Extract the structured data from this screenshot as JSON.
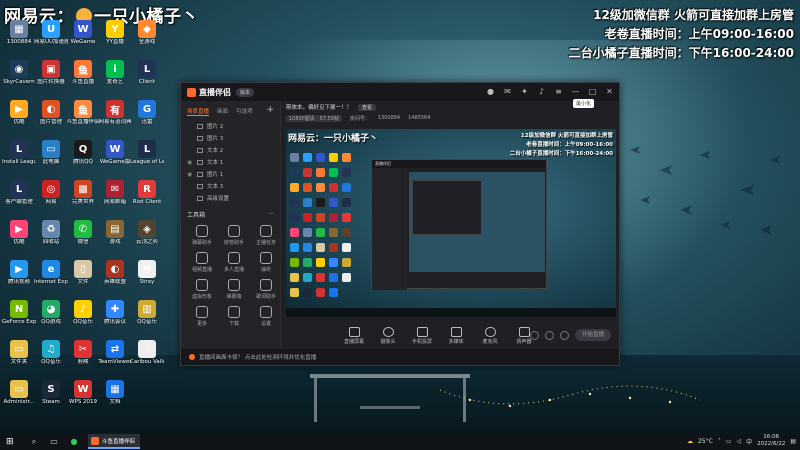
{
  "overlay": {
    "title_left": "网易云：",
    "title_right": "一只小橘子丶",
    "info_lines": [
      "12级加微信群 火箭可直接加群上房管",
      "老卷直播时间：上午09:00-16:00",
      "二台小橘子直播时间：下午16:00-24:00"
    ]
  },
  "desktop_icons": [
    {
      "label": "1300884",
      "color": "#6b7fa0",
      "glyph": "▦"
    },
    {
      "label": "网易UU加速器",
      "color": "#2aa0ff",
      "glyph": "U"
    },
    {
      "label": "WeGame",
      "color": "#3355cc",
      "glyph": "W"
    },
    {
      "label": "YY直播",
      "color": "#ffcc00",
      "glyph": "Y"
    },
    {
      "label": "全游戏",
      "color": "#ff8833",
      "glyph": "◆"
    },
    {
      "label": "SkyrCavern",
      "color": "#1d3b58",
      "glyph": "◉"
    },
    {
      "label": "图片转换器",
      "color": "#cc3333",
      "glyph": "▣"
    },
    {
      "label": "斗鱼直播",
      "color": "#ff7733",
      "glyph": "鱼"
    },
    {
      "label": "爱奇艺",
      "color": "#00c050",
      "glyph": "i"
    },
    {
      "label": "Client",
      "color": "#223355",
      "glyph": "L"
    },
    {
      "label": "优酷",
      "color": "#ffaa22",
      "glyph": "▶"
    },
    {
      "label": "图片管理",
      "color": "#e05020",
      "glyph": "◐"
    },
    {
      "label": "斗鱼直播伴侣",
      "color": "#ff8a3d",
      "glyph": "鱼"
    },
    {
      "label": "网易有道词典",
      "color": "#d03030",
      "glyph": "有"
    },
    {
      "label": "迅雷",
      "color": "#2277dd",
      "glyph": "G"
    },
    {
      "label": "Install League",
      "color": "#223355",
      "glyph": "L"
    },
    {
      "label": "此电脑",
      "color": "#2a80c8",
      "glyph": "▭"
    },
    {
      "label": "腾讯QQ",
      "color": "#1a1a1a",
      "glyph": "Q"
    },
    {
      "label": "WeGame版",
      "color": "#3355cc",
      "glyph": "W"
    },
    {
      "label": "League of Legends",
      "color": "#1e2e4a",
      "glyph": "L"
    },
    {
      "label": "客户端管理",
      "color": "#223355",
      "glyph": "L"
    },
    {
      "label": "网易",
      "color": "#cc2222",
      "glyph": "◎"
    },
    {
      "label": "完美世界",
      "color": "#cc4422",
      "glyph": "▩"
    },
    {
      "label": "网易邮箱",
      "color": "#aa2233",
      "glyph": "✉"
    },
    {
      "label": "Riot Client",
      "color": "#e23b3b",
      "glyph": "R"
    },
    {
      "label": "优酷",
      "color": "#ff4477",
      "glyph": "▶"
    },
    {
      "label": "回收站",
      "color": "#6688aa",
      "glyph": "♻"
    },
    {
      "label": "微信",
      "color": "#22bb44",
      "glyph": "✆"
    },
    {
      "label": "游戏",
      "color": "#886633",
      "glyph": "▤"
    },
    {
      "label": "云顶之弈",
      "color": "#554433",
      "glyph": "◈"
    },
    {
      "label": "腾讯视频",
      "color": "#2299ee",
      "glyph": "▶"
    },
    {
      "label": "Internet Explorer",
      "color": "#1e88e5",
      "glyph": "e"
    },
    {
      "label": "文件",
      "color": "#d8c8a8",
      "glyph": "▯"
    },
    {
      "label": "英雄联盟",
      "color": "#aa3322",
      "glyph": "◐"
    },
    {
      "label": "Stray",
      "color": "#f0f0f0",
      "glyph": "◓"
    },
    {
      "label": "GeForce Experience",
      "color": "#76b900",
      "glyph": "N"
    },
    {
      "label": "QQ游戏",
      "color": "#22aa66",
      "glyph": "◕"
    },
    {
      "label": "QQ音乐",
      "color": "#ffd000",
      "glyph": "♪"
    },
    {
      "label": "腾讯会议",
      "color": "#3388ff",
      "glyph": "✚"
    },
    {
      "label": "QQ音乐",
      "color": "#ccaa33",
      "glyph": "▥"
    },
    {
      "label": "文件夹",
      "color": "#e8c24a",
      "glyph": "▭"
    },
    {
      "label": "QQ音乐",
      "color": "#22aacc",
      "glyph": "♫"
    },
    {
      "label": "剪映",
      "color": "#dd3333",
      "glyph": "✂"
    },
    {
      "label": "TeamViewer",
      "color": "#1a73e8",
      "glyph": "⇄"
    },
    {
      "label": "Caribou Valley",
      "color": "#eeeeee",
      "glyph": "☃"
    },
    {
      "label": "Administr...",
      "color": "#e8c24a",
      "glyph": "▭"
    },
    {
      "label": "Steam",
      "color": "#1b2838",
      "glyph": "S"
    },
    {
      "label": "WPS 2019",
      "color": "#d33333",
      "glyph": "W"
    },
    {
      "label": "文档",
      "color": "#1a73e8",
      "glyph": "▦"
    }
  ],
  "app": {
    "name": "直播伴侣",
    "version": "版本",
    "tooltip": "最小化",
    "side_tabs": [
      "场景直播",
      "画面",
      "可选项"
    ],
    "sources": [
      {
        "label": "图片 2"
      },
      {
        "label": "图片 3"
      },
      {
        "label": "文本 2"
      },
      {
        "label": "文本 1"
      },
      {
        "label": "图片 1"
      },
      {
        "label": "文本 3"
      },
      {
        "label": "高级设置"
      }
    ],
    "tools_heading": "工具箱",
    "tools": [
      {
        "label": "弹幕助手"
      },
      {
        "label": "房管助手"
      },
      {
        "label": "主播任务"
      },
      {
        "label": "视频直播"
      },
      {
        "label": "多人直播"
      },
      {
        "label": "抽奖"
      },
      {
        "label": "虚拟形象"
      },
      {
        "label": "弹幕墙"
      },
      {
        "label": "歌词助手"
      },
      {
        "label": "更多"
      },
      {
        "label": "下载"
      },
      {
        "label": "设置"
      }
    ],
    "notice": "斯旅本，偏好见下展一！！",
    "notice_button": "查看",
    "stats": {
      "quality": "1080P超清 · 57.59帧",
      "fans_label": "房间号：",
      "fans": "1300884",
      "viewers": "1485564"
    },
    "preview": {
      "title": "网易云：一只小橘子丶",
      "info_lines": [
        "12级加微信群 火箭可直接加群上房管",
        "老卷直播时间：上午09:00-16:00",
        "二台小橘子直播时间：下午16:00-24:00"
      ],
      "nested_title": "直播伴侣"
    },
    "bottom_bar": [
      {
        "label": "直播屏幕"
      },
      {
        "label": "摄像头"
      },
      {
        "label": "手机投屏"
      },
      {
        "label": "多媒体"
      },
      {
        "label": "麦克风"
      },
      {
        "label": "扬声器"
      }
    ],
    "go_live": "开始直播",
    "status": "直播间画面卡顿？ 点击此处检测环境并优化直播"
  },
  "taskbar": {
    "app_label": "斗鱼直播伴侣",
    "temperature": "25°C",
    "ime": "中",
    "time": "16:06",
    "date": "2022/6/22"
  }
}
